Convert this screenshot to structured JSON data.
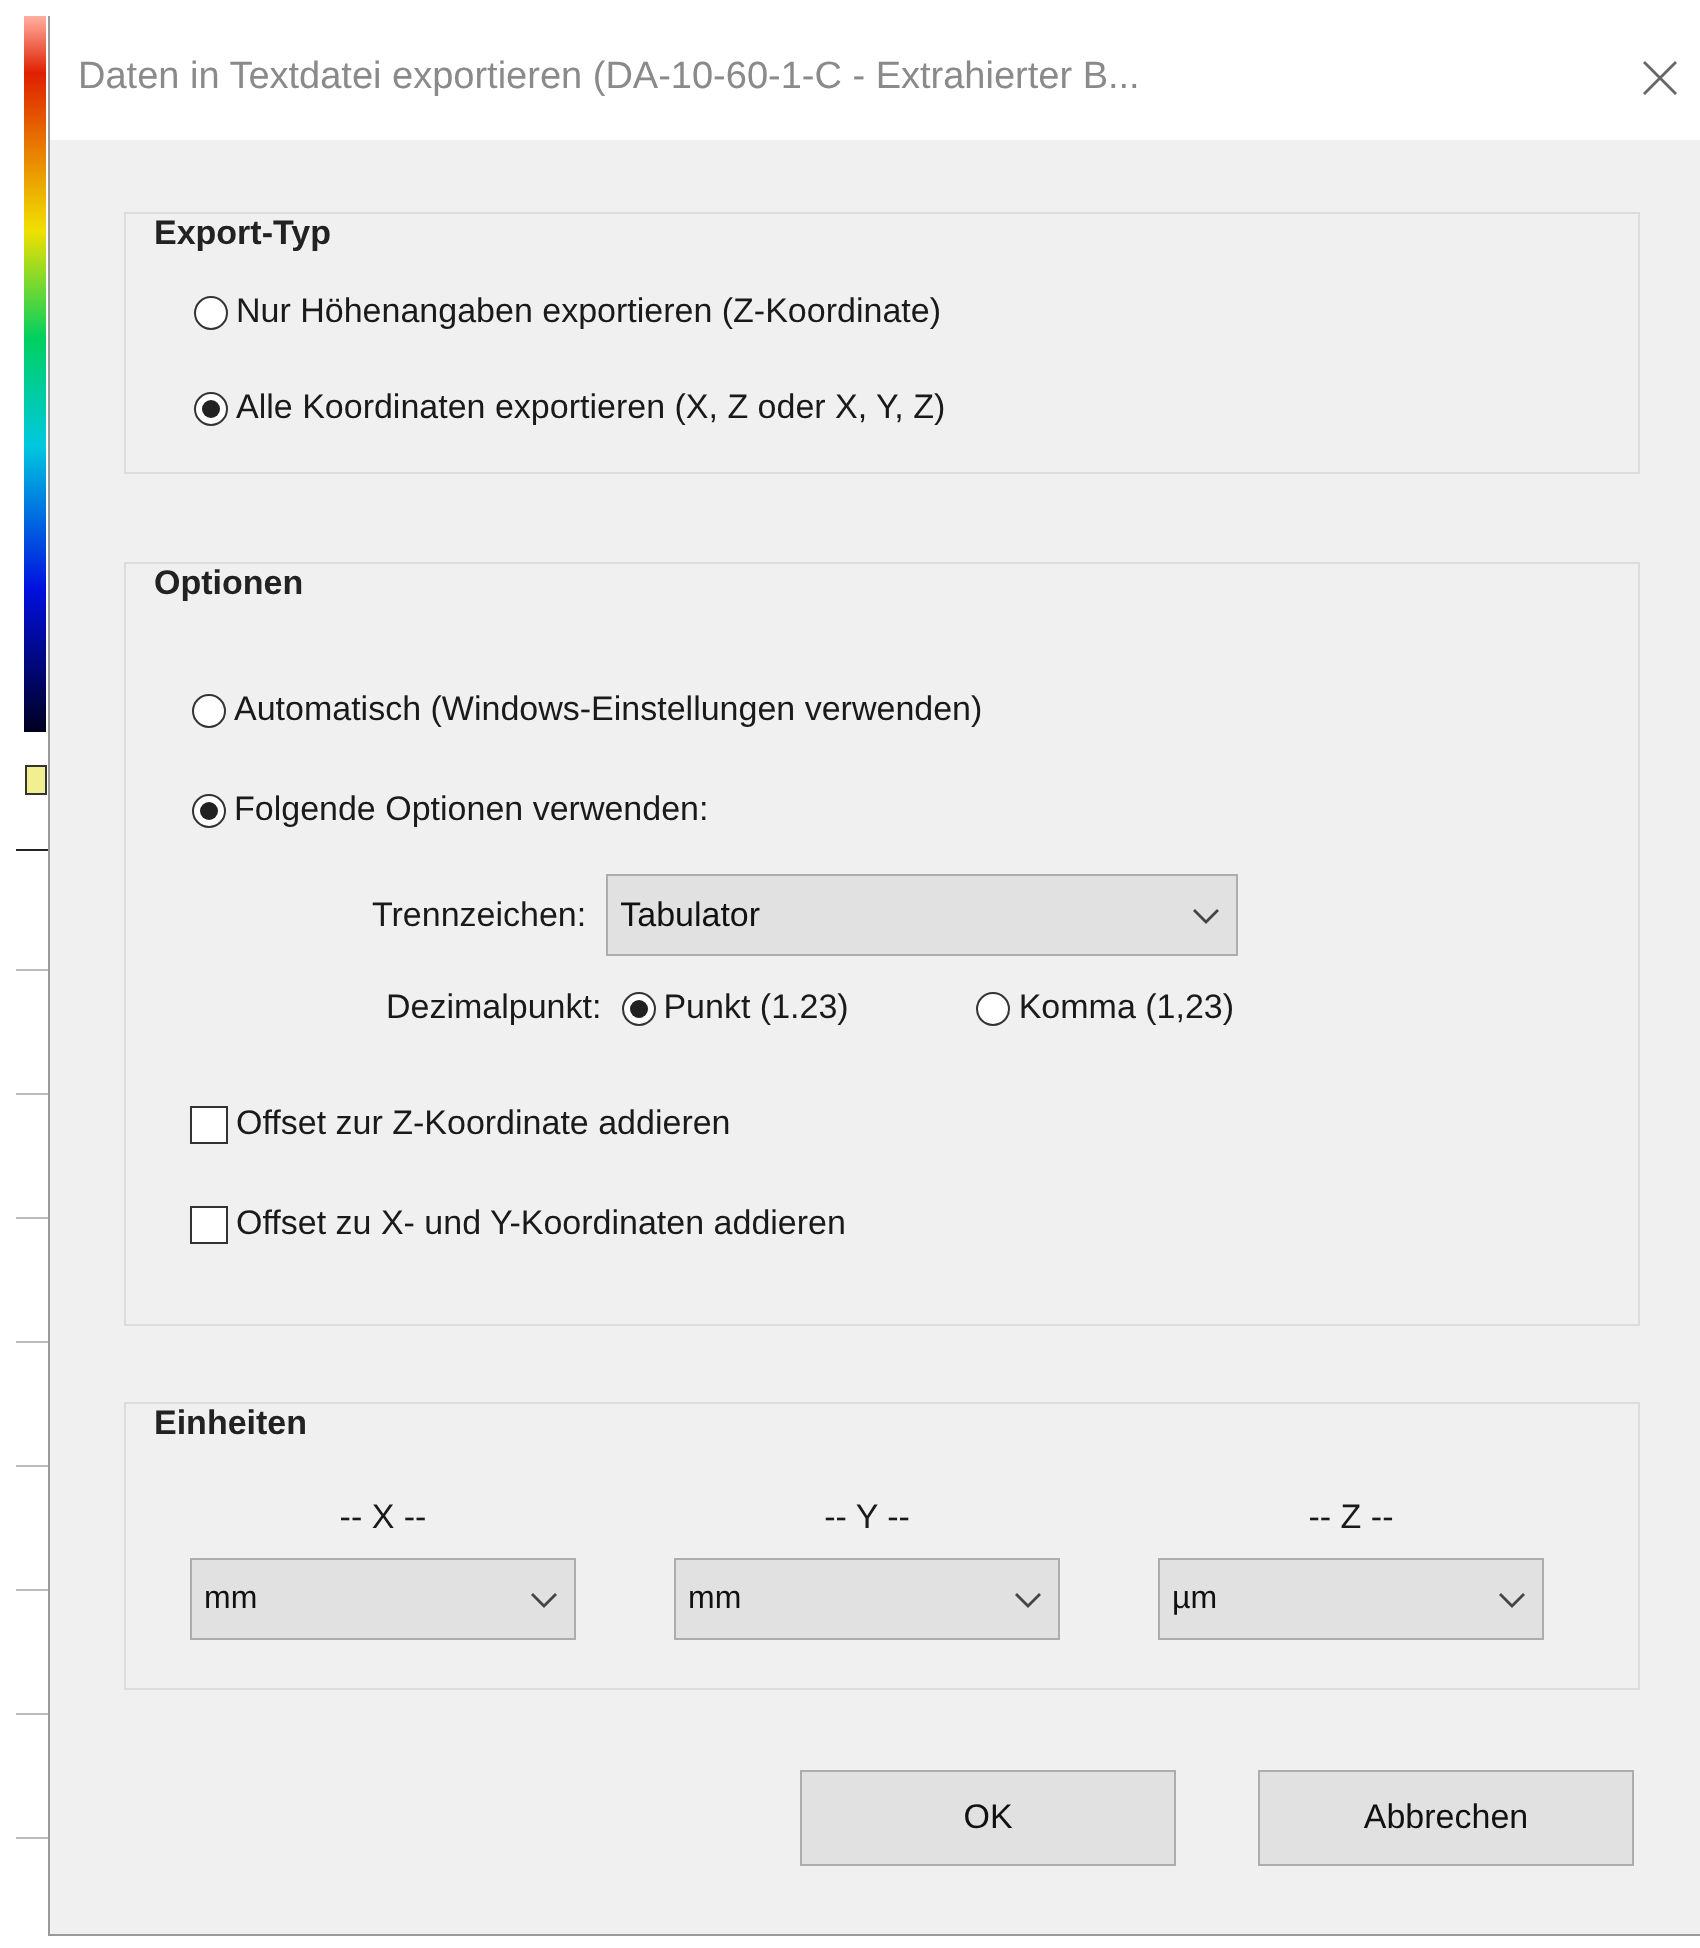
{
  "window": {
    "title": "Daten in Textdatei exportieren (DA-10-60-1-C  - Extrahierter B..."
  },
  "export_type": {
    "title": "Export-Typ",
    "options": [
      {
        "label": "Nur Höhenangaben exportieren (Z-Koordinate)",
        "selected": false
      },
      {
        "label": "Alle Koordinaten exportieren (X, Z oder X, Y, Z)",
        "selected": true
      }
    ]
  },
  "options": {
    "title": "Optionen",
    "modes": [
      {
        "label": "Automatisch (Windows-Einstellungen verwenden)",
        "selected": false
      },
      {
        "label": "Folgende Optionen verwenden:",
        "selected": true
      }
    ],
    "delimiter": {
      "label": "Trennzeichen:",
      "value": "Tabulator"
    },
    "decimal": {
      "label": "Dezimalpunkt:",
      "choices": [
        {
          "label": "Punkt (1.23)",
          "selected": true
        },
        {
          "label": "Komma (1,23)",
          "selected": false
        }
      ]
    },
    "checkboxes": [
      {
        "label": "Offset zur Z-Koordinate addieren",
        "checked": false
      },
      {
        "label": "Offset zu X- und Y-Koordinaten addieren",
        "checked": false
      }
    ]
  },
  "units": {
    "title": "Einheiten",
    "axes": [
      {
        "label": "-- X --",
        "value": "mm"
      },
      {
        "label": "-- Y --",
        "value": "mm"
      },
      {
        "label": "-- Z --",
        "value": "µm"
      }
    ]
  },
  "buttons": [
    "OK",
    "Abbrechen"
  ]
}
